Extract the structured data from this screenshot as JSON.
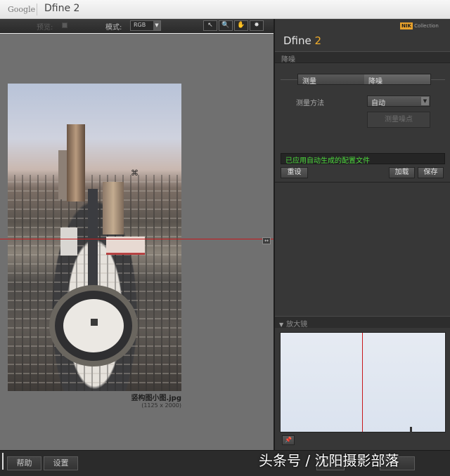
{
  "window": {
    "brand": "Google",
    "title": "Dfine 2"
  },
  "toolbar": {
    "preview_label": "预览:",
    "mode_label": "模式:",
    "mode_value": "RGB",
    "tools": [
      {
        "name": "arrow-tool",
        "glyph": "↖"
      },
      {
        "name": "zoom-tool",
        "glyph": "🔍"
      },
      {
        "name": "hand-tool",
        "glyph": "✋"
      },
      {
        "name": "light-tool",
        "glyph": "✸"
      }
    ]
  },
  "preview": {
    "focus_glyph": "⌘",
    "filename": "竖构图小图.jpg",
    "dimensions": "(1125 x 2000)",
    "split_handle_glyph": "↔"
  },
  "panel": {
    "logo_nik": "NIK",
    "logo_collection": "Collection",
    "product_name": "Dfine",
    "product_version": "2",
    "section_title": "降噪",
    "tabs": [
      "测量",
      "降噪"
    ],
    "method_label": "测量方法",
    "method_value": "自动",
    "measure_points_label": "测量噪点",
    "status_message": "已应用自动生成的配置文件",
    "reset_label": "重设",
    "load_label": "加载",
    "save_label": "保存",
    "loupe_title": "放大镜",
    "pin_glyph": "📌"
  },
  "bottom": {
    "help_label": "帮助",
    "settings_label": "设置",
    "watermark": "头条号 / 沈阳摄影部落"
  },
  "colors": {
    "accent_orange": "#f0ad2c",
    "status_green": "#4cd63c",
    "split_red": "#c8171b"
  }
}
